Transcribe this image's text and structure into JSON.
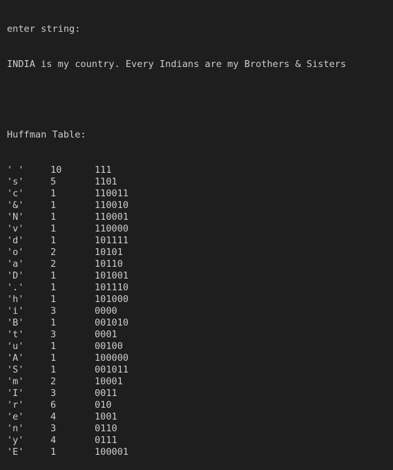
{
  "terminal": {
    "prompt": "enter string:",
    "input_line": "INDIA is my country. Every Indians are my Brothers & Sisters",
    "table_title": "Huffman Table:",
    "rows": [
      {
        "char": "' '",
        "freq": "10",
        "code": "111"
      },
      {
        "char": "'s'",
        "freq": "5",
        "code": "1101"
      },
      {
        "char": "'c'",
        "freq": "1",
        "code": "110011"
      },
      {
        "char": "'&'",
        "freq": "1",
        "code": "110010"
      },
      {
        "char": "'N'",
        "freq": "1",
        "code": "110001"
      },
      {
        "char": "'v'",
        "freq": "1",
        "code": "110000"
      },
      {
        "char": "'d'",
        "freq": "1",
        "code": "101111"
      },
      {
        "char": "'o'",
        "freq": "2",
        "code": "10101"
      },
      {
        "char": "'a'",
        "freq": "2",
        "code": "10110"
      },
      {
        "char": "'D'",
        "freq": "1",
        "code": "101001"
      },
      {
        "char": "'.'",
        "freq": "1",
        "code": "101110"
      },
      {
        "char": "'h'",
        "freq": "1",
        "code": "101000"
      },
      {
        "char": "'i'",
        "freq": "3",
        "code": "0000"
      },
      {
        "char": "'B'",
        "freq": "1",
        "code": "001010"
      },
      {
        "char": "'t'",
        "freq": "3",
        "code": "0001"
      },
      {
        "char": "'u'",
        "freq": "1",
        "code": "00100"
      },
      {
        "char": "'A'",
        "freq": "1",
        "code": "100000"
      },
      {
        "char": "'S'",
        "freq": "1",
        "code": "001011"
      },
      {
        "char": "'m'",
        "freq": "2",
        "code": "10001"
      },
      {
        "char": "'I'",
        "freq": "3",
        "code": "0011"
      },
      {
        "char": "'r'",
        "freq": "6",
        "code": "010"
      },
      {
        "char": "'e'",
        "freq": "4",
        "code": "1001"
      },
      {
        "char": "'n'",
        "freq": "3",
        "code": "0110"
      },
      {
        "char": "'y'",
        "freq": "4",
        "code": "0111"
      },
      {
        "char": "'E'",
        "freq": "1",
        "code": "100001"
      }
    ]
  },
  "colors": {
    "background": "#1e1e1e",
    "text": "#cccccc"
  }
}
